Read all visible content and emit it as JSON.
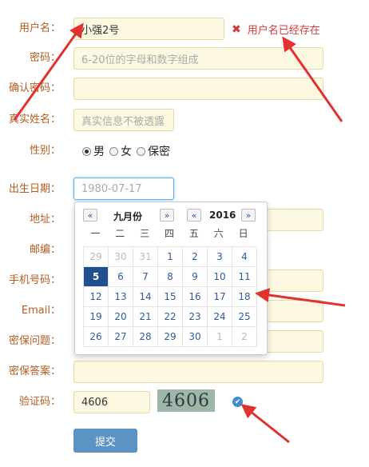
{
  "form": {
    "username": {
      "label": "用户名：",
      "value": "小强2号",
      "error": "用户名已经存在",
      "error_icon": "✖"
    },
    "password": {
      "label": "密码：",
      "placeholder": "6-20位的字母和数字组成"
    },
    "confirm_password": {
      "label": "确认密码："
    },
    "real_name": {
      "label": "真实姓名：",
      "placeholder": "真实信息不被透露"
    },
    "gender": {
      "label": "性别：",
      "options": [
        "男",
        "女",
        "保密"
      ],
      "selected": "男"
    },
    "birth_date": {
      "label": "出生日期：",
      "placeholder": "1980-07-17"
    },
    "address": {
      "label": "地址："
    },
    "postcode": {
      "label": "邮编："
    },
    "phone": {
      "label": "手机号码："
    },
    "email": {
      "label": "Email："
    },
    "security_question": {
      "label": "密保问题："
    },
    "security_answer": {
      "label": "密保答案："
    },
    "captcha": {
      "label": "验证码：",
      "value": "4606",
      "image_text": "4606",
      "check_icon": "check-circle-icon"
    },
    "submit_label": "提交"
  },
  "calendar": {
    "month_label": "九月份",
    "year_label": "2016",
    "prev": "«",
    "next": "»",
    "weekdays": [
      "一",
      "二",
      "三",
      "四",
      "五",
      "六",
      "日"
    ],
    "weeks": [
      [
        "29",
        "30",
        "31",
        "1",
        "2",
        "3",
        "4"
      ],
      [
        "5",
        "6",
        "7",
        "8",
        "9",
        "10",
        "11"
      ],
      [
        "12",
        "13",
        "14",
        "15",
        "16",
        "17",
        "18"
      ],
      [
        "19",
        "20",
        "21",
        "22",
        "23",
        "24",
        "25"
      ],
      [
        "26",
        "27",
        "28",
        "29",
        "30",
        "1",
        "2"
      ]
    ],
    "muted_cells": [
      "0-0",
      "0-1",
      "0-2",
      "4-5",
      "4-6"
    ],
    "selected_cell": "1-0"
  },
  "colors": {
    "label": "#b35c1e",
    "error": "#d23b3b",
    "input_bg": "#fdf8e1",
    "accent": "#22508f",
    "button": "#5b94c4",
    "arrow": "#e0322f"
  }
}
